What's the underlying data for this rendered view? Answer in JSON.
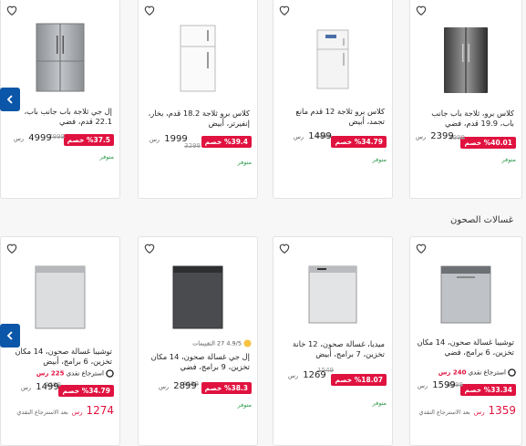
{
  "currency": "رس",
  "stock_label": "متوفر",
  "section_dishwashers": {
    "title": "غسالات الصحون"
  },
  "fridges": [
    {
      "title": "كلاس برو، ثلاجة باب جانب باب، 19.9 قدم، فضي",
      "badge": "%40.01 خصم",
      "old": "3998",
      "price": "2399"
    },
    {
      "title": "كلاس برو ثلاجة 12 قدم مانع تجمد، أبيض",
      "badge": "%34.79 خصم",
      "old": "2299",
      "price": "1499"
    },
    {
      "title": "كلاس برو ثلاجة 18.2 قدم، بخار، إنفيرتر، أبيض",
      "badge": "%39.4 خصم",
      "old": "3299",
      "price": "1999"
    },
    {
      "title": "إل جي ثلاجة باب جانب باب، 22.1 قدم، فضي",
      "badge": "%37.5 خصم",
      "old": "7999",
      "price": "4999"
    }
  ],
  "dishwashers": [
    {
      "title": "توشيبا غسالة صحون، 14 مكان تخزين، 6 برامج، فضي",
      "badge": "%33.34 خصم",
      "old": "2399",
      "price": "1599",
      "tabby": "استرجاع نقدي",
      "tabby_amount": "240 رس",
      "big_price": "1359",
      "big_note": "بعد الاسترجاع النقدي"
    },
    {
      "title": "ميديا، غسالة صحون، 12 خانة تخزين، 7 برامج، أبيض",
      "badge": "%18.07 خصم",
      "old": "1549",
      "price": "1269"
    },
    {
      "title": "إل جي غسالة صحون، 14 مكان تخزين، 9 برامج، فضي",
      "badge": "%38.3 خصم",
      "old": "4699",
      "price": "2899",
      "rating": "4.9/5",
      "reviews": "27 التقييمات"
    },
    {
      "title": "توشيبا غسالة صحون، 14 مكان تخزين، 6 برامج، أبيض",
      "badge": "%34.79 خصم",
      "old": "2299",
      "price": "1499",
      "tabby": "استرجاع نقدي",
      "tabby_amount": "225 رس",
      "big_price": "1274",
      "big_note": "بعد الاسترجاع النقدي"
    }
  ]
}
